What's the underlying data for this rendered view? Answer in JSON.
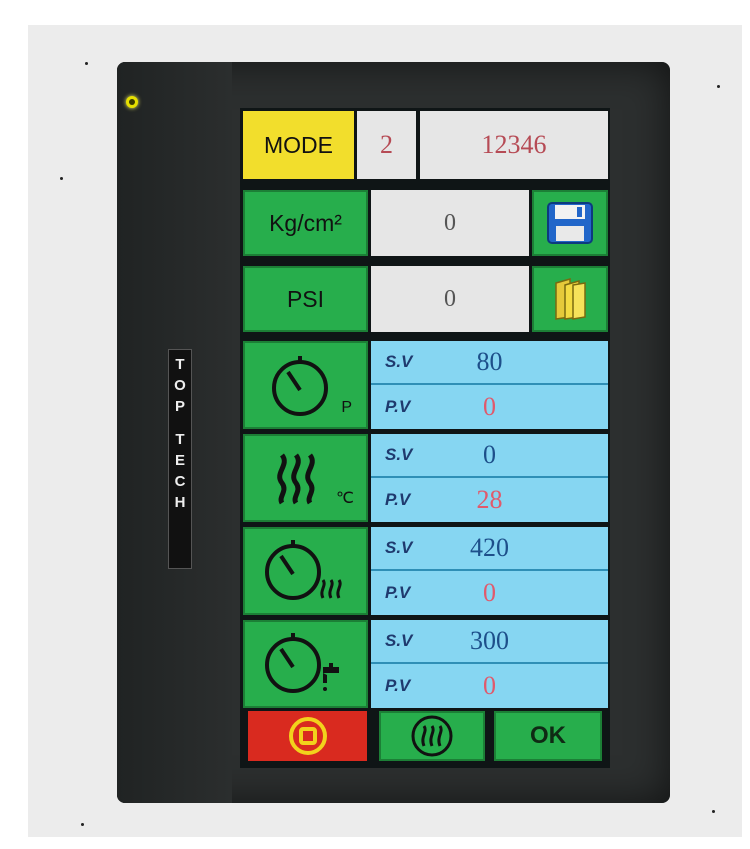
{
  "brand": {
    "letters_top": [
      "T",
      "O",
      "P"
    ],
    "letters_bottom": [
      "T",
      "E",
      "C",
      "H"
    ]
  },
  "mode": {
    "label": "MODE",
    "number": "2",
    "code": "12346"
  },
  "pressure_kg": {
    "label": "Kg/cm²",
    "value": "0",
    "icon": "floppy-save-icon"
  },
  "pressure_psi": {
    "label": "PSI",
    "value": "0",
    "icon": "folder-open-icon"
  },
  "rows": [
    {
      "icon": "timer-pressure-icon",
      "unit": "P",
      "sv_label": "S.V",
      "sv": "80",
      "pv_label": "P.V",
      "pv": "0"
    },
    {
      "icon": "heat-temperature-icon",
      "unit": "℃",
      "sv_label": "S.V",
      "sv": "0",
      "pv_label": "P.V",
      "pv": "28"
    },
    {
      "icon": "timer-heat-icon",
      "unit": "",
      "sv_label": "S.V",
      "sv": "420",
      "pv_label": "P.V",
      "pv": "0"
    },
    {
      "icon": "timer-water-tap-icon",
      "unit": "",
      "sv_label": "S.V",
      "sv": "300",
      "pv_label": "P.V",
      "pv": "0"
    }
  ],
  "buttons": {
    "stop_icon": "stop-icon",
    "heat_icon": "heater-icon",
    "ok_label": "OK"
  },
  "colors": {
    "green": "#27ae4c",
    "yellow": "#f2de2c",
    "sky": "#86d6f2",
    "red": "#d92a1f",
    "value_red": "#b64b55"
  }
}
